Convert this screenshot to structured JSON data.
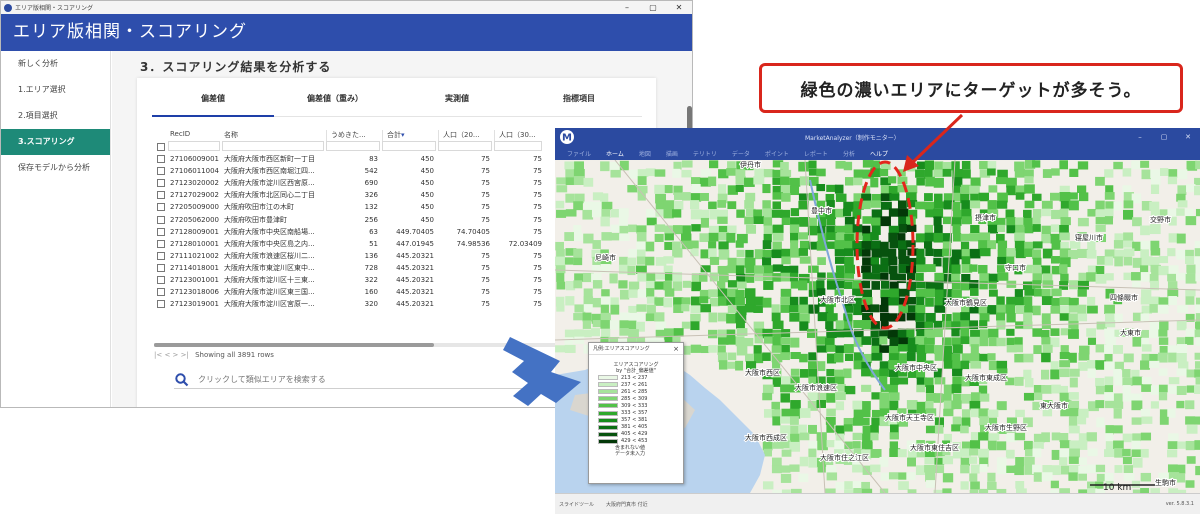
{
  "left_window": {
    "titlebar": {
      "title": "エリア版相関・スコアリング",
      "minimize": "–",
      "maximize": "▢",
      "close": "✕"
    },
    "header_title": "エリア版相関・スコアリング",
    "sidebar": {
      "items": [
        {
          "label": "新しく分析"
        },
        {
          "label": "1.エリア選択"
        },
        {
          "label": "2.項目選択"
        },
        {
          "label": "3.スコアリング"
        },
        {
          "label": "保存モデルから分析"
        }
      ]
    },
    "heading": "3．スコアリング結果を分析する",
    "tabs": [
      {
        "label": "偏差値"
      },
      {
        "label": "偏差値（重み）"
      },
      {
        "label": "実測値"
      },
      {
        "label": "指標項目"
      }
    ],
    "grid": {
      "columns": [
        "RecID",
        "名称",
        "うめきた...",
        "合計",
        "人口（20...",
        "人口（30..."
      ],
      "rows": [
        [
          "27106009001",
          "大阪府大阪市西区新町一丁目",
          "83",
          "450",
          "75",
          "75"
        ],
        [
          "27106011004",
          "大阪府大阪市西区南堀江四...",
          "542",
          "450",
          "75",
          "75"
        ],
        [
          "27123020002",
          "大阪府大阪市淀川区西宮原...",
          "690",
          "450",
          "75",
          "75"
        ],
        [
          "27127029002",
          "大阪府大阪市北区同心二丁目",
          "326",
          "450",
          "75",
          "75"
        ],
        [
          "27205009000",
          "大阪府吹田市江の木町",
          "132",
          "450",
          "75",
          "75"
        ],
        [
          "27205062000",
          "大阪府吹田市豊津町",
          "256",
          "450",
          "75",
          "75"
        ],
        [
          "27128009001",
          "大阪府大阪市中央区南船場...",
          "63",
          "449.70405",
          "74.70405",
          "75"
        ],
        [
          "27128010001",
          "大阪府大阪市中央区島之内...",
          "51",
          "447.01945",
          "74.98536",
          "72.03409"
        ],
        [
          "27111021002",
          "大阪府大阪市浪速区桜川二...",
          "136",
          "445.20321",
          "75",
          "75"
        ],
        [
          "27114018001",
          "大阪府大阪市東淀川区東中...",
          "728",
          "445.20321",
          "75",
          "75"
        ],
        [
          "27123001001",
          "大阪府大阪市淀川区十三東...",
          "322",
          "445.20321",
          "75",
          "75"
        ],
        [
          "27123018006",
          "大阪府大阪市淀川区東三国...",
          "160",
          "445.20321",
          "75",
          "75"
        ],
        [
          "27123019001",
          "大阪府大阪市淀川区宮原一...",
          "320",
          "445.20321",
          "75",
          "75"
        ]
      ]
    },
    "pager": {
      "nav": "|< < > >|",
      "text": "Showing all 3891 rows"
    },
    "search_placeholder": "クリックして類似エリアを検索する"
  },
  "map_window": {
    "titlebar": {
      "title": "MarketAnalyzer（制作モニター）",
      "minimize": "–",
      "maximize": "▢",
      "close": "✕"
    },
    "menu": [
      "ファイル",
      "ホーム",
      "地図",
      "描画",
      "テリトリ",
      "データ",
      "ポイント",
      "レポート",
      "分析",
      "ヘルプ"
    ],
    "status": {
      "left": "スライドツール",
      "area": "大阪府門真市 付近",
      "version": "ver. 5.8.3.1"
    },
    "scale": "10 km",
    "cities": [
      "伊丹市",
      "豊中市",
      "摂津市",
      "寝屋川市",
      "交野市",
      "尼崎市",
      "守口市",
      "四條畷市",
      "大阪市北区",
      "大阪市鶴見区",
      "大東市",
      "大阪市中央区",
      "大阪市東成区",
      "東大阪市",
      "大阪市西区",
      "大阪市浪速区",
      "大阪市天王寺区",
      "大阪市生野区",
      "大阪市住之江区",
      "大阪市西成区",
      "大阪市東住吉区",
      "生駒市"
    ],
    "legend": {
      "title": "凡例:エリアスコアリング",
      "heading": "エリアスコアリング",
      "subheading": "by \"合計_偏差値\"",
      "ranges": [
        {
          "label": "213 < 237",
          "color": "#eaf8e6"
        },
        {
          "label": "237 < 261",
          "color": "#c9efc2"
        },
        {
          "label": "261 < 285",
          "color": "#a6e39b"
        },
        {
          "label": "285 < 309",
          "color": "#7ed571"
        },
        {
          "label": "309 < 333",
          "color": "#52c148"
        },
        {
          "label": "333 < 357",
          "color": "#2fa82c"
        },
        {
          "label": "357 < 381",
          "color": "#178c1d"
        },
        {
          "label": "381 < 405",
          "color": "#0b6f14"
        },
        {
          "label": "405 < 429",
          "color": "#07520e"
        },
        {
          "label": "429 < 453",
          "color": "#033808"
        }
      ],
      "footer1": "含まれない値",
      "footer2": "データ未入力"
    }
  },
  "callout_text": "緑色の濃いエリアにターゲットが多そう。",
  "colors": {
    "header_blue": "#2e4eac",
    "active_green": "#1e8a78",
    "callout_red": "#d9261c",
    "arrow_blue": "#4472c4"
  }
}
